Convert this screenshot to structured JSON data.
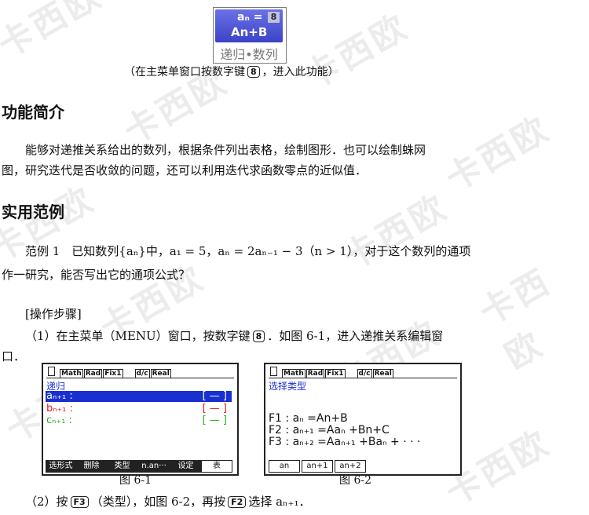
{
  "watermark": "卡西欧",
  "menu_icon": {
    "formula_line1": "aₙ =",
    "formula_line2": "An+B",
    "number": "8",
    "caption": "递归•数列"
  },
  "intro_note": {
    "before": "（在主菜单窗口按数字键",
    "key": "8",
    "after": "，进入此功能）"
  },
  "section1": {
    "title": "功能简介",
    "text_line1": "能够对递推关系给出的数列，根据条件列出表格，绘制图形．也可以绘制蛛网",
    "text_line2": "图，研究迭代是否收敛的问题，还可以利用迭代求函数零点的近似值．"
  },
  "section2": {
    "title": "实用范例",
    "example_line1": "范例 1　已知数列{aₙ}中，a₁ = 5，aₙ = 2aₙ₋₁ − 3（n > 1），对于这个数列的通项",
    "example_line2": "作一研究，能否写出它的通项公式？",
    "steps_heading": "[操作步骤]",
    "step1_line1": {
      "before": "（1）在主菜单（MENU）窗口，按数字键",
      "key": "8",
      "after": "．如图 6-1，进入递推关系编辑窗"
    },
    "step1_line2": "口．",
    "step2": {
      "before": "（2）按",
      "key1": "F3",
      "middle": "（类型），如图 6-2，再按",
      "key2": "F2",
      "after": "选择 aₙ₊₁．"
    }
  },
  "screen1": {
    "status": [
      "Math",
      "Rad",
      "Fix1",
      "d/c",
      "Real"
    ],
    "title": "递归",
    "rows": [
      {
        "label": "aₙ₊₁ :",
        "bracket": "[ — ]",
        "color": "#ffffff"
      },
      {
        "label": "bₙ₊₁ :",
        "bracket": "[ — ]",
        "color": "#e02020"
      },
      {
        "label": "cₙ₊₁ :",
        "bracket": "[ — ]",
        "color": "#20b020"
      }
    ],
    "fkeys": [
      "选形式",
      "删除",
      "类型",
      "n.an···",
      "设定",
      "表"
    ],
    "caption": "图 6-1"
  },
  "screen2": {
    "status": [
      "Math",
      "Rad",
      "Fix1",
      "d/c",
      "Real"
    ],
    "title": "选择类型",
    "lines": [
      "F1 : aₙ =An+B",
      "F2 : aₙ₊₁ =Aaₙ +Bn+C",
      "F3 : aₙ₊₂ =Aaₙ₊₁ +Baₙ + · · ·"
    ],
    "fkeys": [
      "an",
      "an+1",
      "an+2"
    ],
    "caption": "图 6-2"
  },
  "colors": {
    "highlight": "#1a2fd0",
    "title_blue": "#1a2fd0",
    "red": "#e02020",
    "green": "#20b020"
  }
}
